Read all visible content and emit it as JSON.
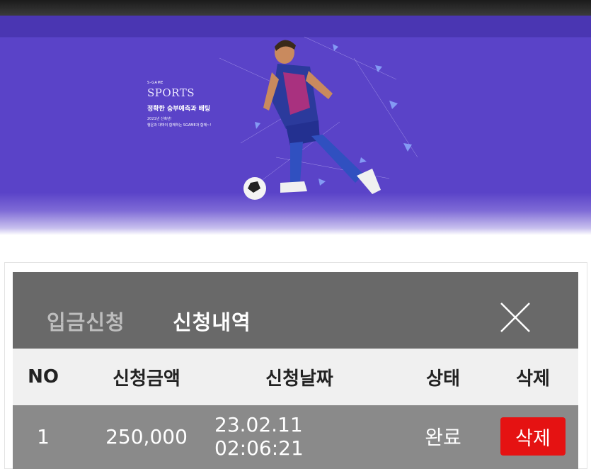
{
  "banner": {
    "eyebrow": "S-GAME",
    "title": "SPORTS",
    "subtitle": "정확한 승부예측과 배팅",
    "line1": "2021년 신축년!",
    "line2": "행운과 대박이 함께하는 SGAME과 함께~!"
  },
  "tabs": {
    "deposit": "입금신청",
    "history": "신청내역"
  },
  "table": {
    "headers": {
      "no": "NO",
      "amount": "신청금액",
      "date": "신청날짜",
      "status": "상태",
      "delete": "삭제"
    },
    "rows": [
      {
        "no": "1",
        "amount": "250,000",
        "date": "23.02.11 02:06:21",
        "status": "완료",
        "delete": "삭제"
      }
    ]
  },
  "colors": {
    "banner": "#5a43c8",
    "header": "#696969",
    "row": "#8a8a8a",
    "delete": "#e51212"
  }
}
